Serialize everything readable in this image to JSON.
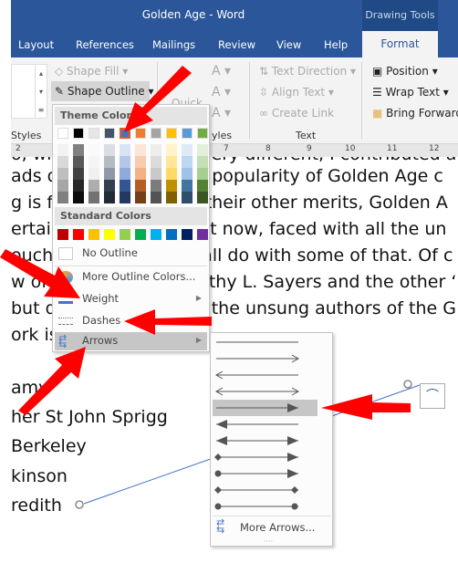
{
  "window": {
    "title": "Golden Age  -  Word",
    "context_tab": "Drawing Tools"
  },
  "tabs": [
    "Layout",
    "References",
    "Mailings",
    "Review",
    "View",
    "Help",
    "Format"
  ],
  "ribbon": {
    "shape_fill": "Shape Fill",
    "shape_outline": "Shape Outline",
    "quick": "Quick",
    "text_direction": "Text Direction",
    "align_text": "Align Text",
    "create_link": "Create Link",
    "position": "Position",
    "wrap_text": "Wrap Text",
    "bring_forward": "Bring Forward",
    "group_styles": "Styles",
    "group_wordart": "yles",
    "group_text": "Text"
  },
  "ruler": [
    "2",
    "7",
    "8",
    "9",
    "10",
    "11",
    "12"
  ],
  "document": {
    "lines": [
      "o, wh                          very different, I contributed a",
      "ads d                      l of popularity of Golden Age c",
      "g is fo                     all their other merits, Golden A",
      "ertain                      ight now, faced with all the un",
      "ouch                        n all do with some of that. Of c",
      "w of A                       rothy L. Sayers and the other ‘",
      "but d                        re the unsung authors of the G",
      "ork is  worth exploring."
    ],
    "names": [
      "amy",
      "her St John Sprigg",
      "Berkeley",
      "kinson",
      "redith"
    ]
  },
  "menu": {
    "theme_colors": "Theme Colors",
    "standard_colors": "Standard Colors",
    "no_outline": "No Outline",
    "more_colors": "More Outline Colors...",
    "weight": "Weight",
    "dashes": "Dashes",
    "arrows": "Arrows",
    "theme_swatches": [
      "#ffffff",
      "#000000",
      "#e7e6e6",
      "#44546a",
      "#4472c4",
      "#ed7d31",
      "#a5a5a5",
      "#ffc000",
      "#5b9bd5",
      "#70ad47"
    ],
    "standard_swatches": [
      "#c00000",
      "#ff0000",
      "#ffc000",
      "#ffff00",
      "#92d050",
      "#00b050",
      "#00b0f0",
      "#0070c0",
      "#002060",
      "#7030a0"
    ],
    "selected_theme_color": "#4472c4"
  },
  "arrows_submenu": {
    "styles": [
      "none",
      "open-end",
      "open-start",
      "open-both",
      "triangle-end",
      "triangle-start",
      "triangle-both",
      "diamond-triangle",
      "oval-triangle",
      "diamond-both",
      "oval-both"
    ],
    "selected": "triangle-end",
    "more": "More Arrows..."
  },
  "annotation_color": "#ff0000"
}
